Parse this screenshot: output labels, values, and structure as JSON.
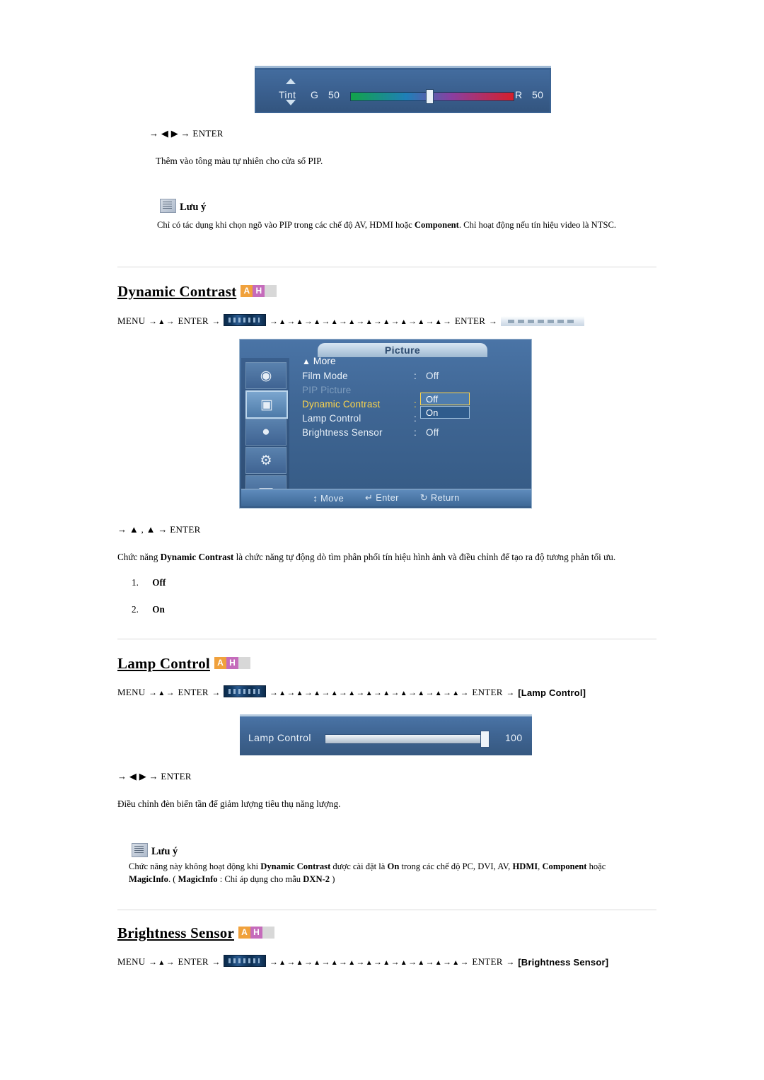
{
  "section_tint": {
    "osd": {
      "label": "Tint",
      "left_letter": "G",
      "left_value": "50",
      "right_letter": "R",
      "right_value": "50"
    },
    "key_sequence": "→ ◀ ▶ → ENTER",
    "description": "Thêm vào tông màu tự nhiên cho cửa sổ PIP.",
    "note": {
      "title": "Lưu ý",
      "text_parts": [
        {
          "t": "Chỉ có tác dụng khi chọn ngõ vào PIP trong các chế độ AV, HDMI hoặc ",
          "b": false
        },
        {
          "t": "Component",
          "b": true
        },
        {
          "t": ". Chỉ hoạt động nếu tín hiệu video là NTSC.",
          "b": false
        }
      ]
    }
  },
  "section_dynamic_contrast": {
    "heading": "Dynamic Contrast",
    "badges": [
      "A",
      "H",
      ""
    ],
    "menu_path": {
      "start": "MENU",
      "enter1": "ENTER",
      "enter2": "ENTER",
      "arrow_count": 11,
      "end_label": ""
    },
    "osd": {
      "title": "Picture",
      "more": "More",
      "rows": [
        {
          "label": "Film Mode",
          "value": "Off",
          "state": "normal"
        },
        {
          "label": "PIP Picture",
          "value": "",
          "state": "dim"
        },
        {
          "label": "Dynamic Contrast",
          "value": "",
          "state": "highlight"
        },
        {
          "label": "Lamp Control",
          "value": "",
          "state": "normal"
        },
        {
          "label": "Brightness Sensor",
          "value": "Off",
          "state": "normal"
        }
      ],
      "dropdown": {
        "option_selected": "Off",
        "option_other": "On"
      },
      "footer": {
        "move": "Move",
        "enter": "Enter",
        "return": "Return"
      }
    },
    "key_sequence": "→ ▲ , ▲ → ENTER",
    "description_parts": [
      {
        "t": "Chức năng ",
        "b": false
      },
      {
        "t": "Dynamic Contrast",
        "b": true
      },
      {
        "t": " là chức năng tự động dò tìm phân phối tín hiệu hình ảnh và điều chỉnh để tạo ra độ tương phản tối ưu.",
        "b": false
      }
    ],
    "options": [
      {
        "num": "1.",
        "label": "Off"
      },
      {
        "num": "2.",
        "label": "On"
      }
    ]
  },
  "section_lamp_control": {
    "heading": "Lamp Control",
    "badges": [
      "A",
      "H",
      ""
    ],
    "menu_path": {
      "start": "MENU",
      "enter1": "ENTER",
      "enter2": "ENTER",
      "end_label": "[Lamp Control]"
    },
    "osd": {
      "label": "Lamp Control",
      "value": "100"
    },
    "key_sequence": "→ ◀ ▶ → ENTER",
    "description": "Điều chỉnh đèn biến tần để giảm lượng tiêu thụ năng lượng.",
    "note": {
      "title": "Lưu ý",
      "line1_parts": [
        {
          "t": "Chức năng này không hoạt động khi ",
          "b": false
        },
        {
          "t": "Dynamic Contrast",
          "b": true
        },
        {
          "t": " được cài đặt là ",
          "b": false
        },
        {
          "t": "On",
          "b": true
        },
        {
          "t": " trong các chế độ PC, DVI, AV, ",
          "b": false
        },
        {
          "t": "HDMI",
          "b": true
        },
        {
          "t": ", ",
          "b": false
        },
        {
          "t": "Component",
          "b": true
        },
        {
          "t": " hoặc",
          "b": false
        }
      ],
      "line2_parts": [
        {
          "t": "MagicInfo",
          "b": true
        },
        {
          "t": ". ( ",
          "b": false
        },
        {
          "t": "MagicInfo",
          "b": true
        },
        {
          "t": " : Chỉ áp dụng cho mẫu ",
          "b": false
        },
        {
          "t": "DXN-2",
          "b": true
        },
        {
          "t": " )",
          "b": false
        }
      ]
    }
  },
  "section_brightness_sensor": {
    "heading": "Brightness Sensor",
    "badges": [
      "A",
      "H",
      ""
    ],
    "menu_path": {
      "start": "MENU",
      "enter1": "ENTER",
      "enter2": "ENTER",
      "end_label": "[Brightness Sensor]"
    }
  },
  "icons": {
    "menu_thumb": "osd-menu-thumbnail-icon",
    "dynamic_thumb": "dynamic-contrast-thumbnail-icon",
    "note": "note-book-icon",
    "move": "move-arrows-icon",
    "enter": "enter-key-icon",
    "return": "return-arrow-icon"
  },
  "colors": {
    "badge_a": "#f0a13c",
    "badge_h": "#c56bbb",
    "osd_blue": "#3f6694",
    "highlight_yellow": "#ffd64a"
  }
}
